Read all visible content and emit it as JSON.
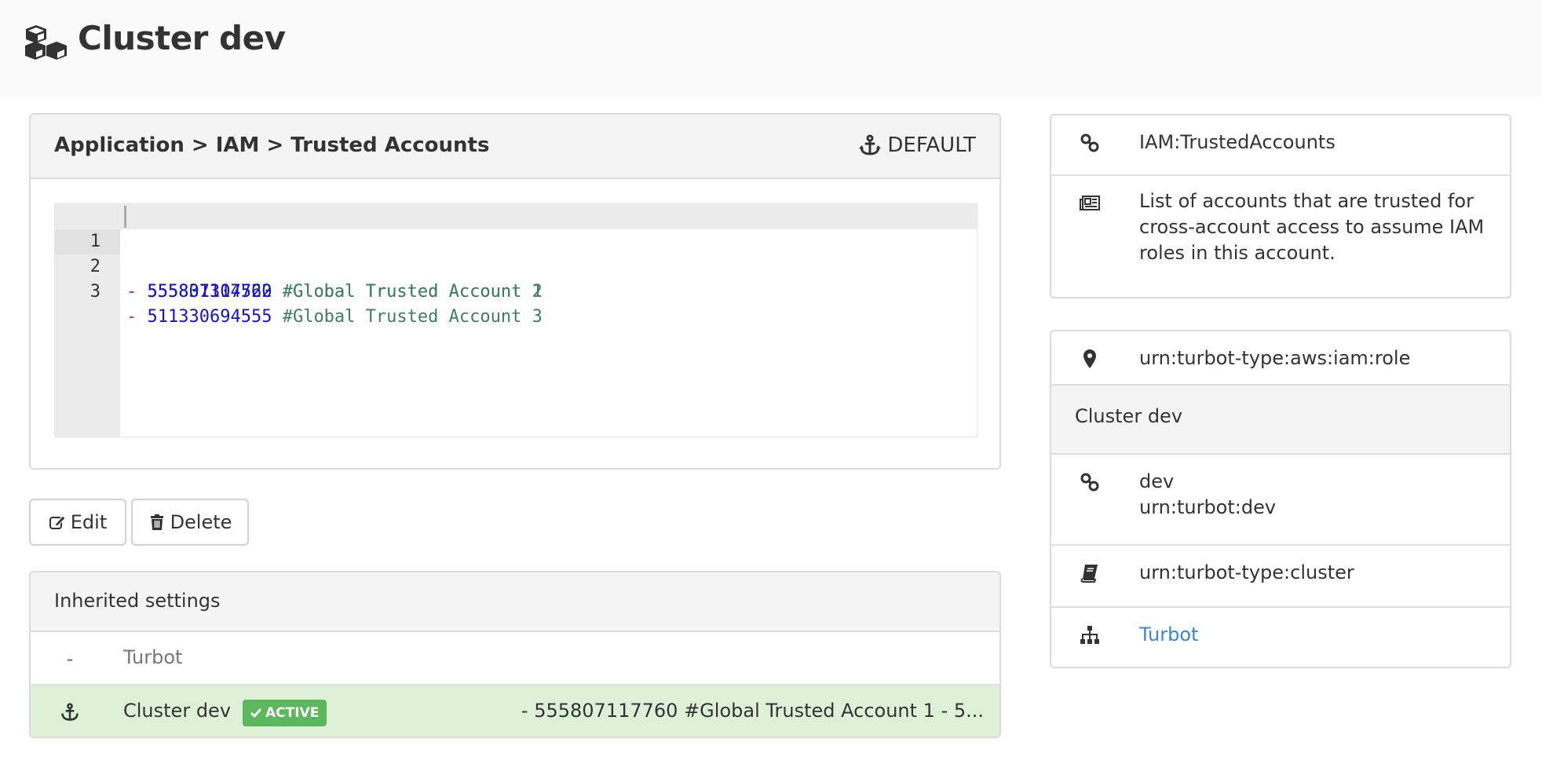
{
  "page": {
    "title": "Cluster dev",
    "title_icon": "cubes-icon"
  },
  "policy": {
    "breadcrumb": "Application > IAM > Trusted Accounts",
    "default_label": "DEFAULT",
    "default_icon": "anchor-icon",
    "editor_lines": [
      {
        "number": "1",
        "dash": "-",
        "account": "555807117760",
        "comment": "#Global Trusted Account 1"
      },
      {
        "number": "2",
        "dash": "-",
        "account": "555831304522",
        "comment": "#Global Trusted Account 2"
      },
      {
        "number": "3",
        "dash": "-",
        "account": "511330694555",
        "comment": "#Global Trusted Account 3"
      }
    ]
  },
  "actions": {
    "edit_label": "Edit",
    "delete_label": "Delete"
  },
  "inherited": {
    "title": "Inherited settings",
    "rows": [
      {
        "marker": "-",
        "name": "Turbot",
        "value": "",
        "active": false
      },
      {
        "marker": "anchor-icon",
        "name": "Cluster dev",
        "badge": "ACTIVE",
        "value": "- 555807117760 #Global Trusted Account 1 - 5...",
        "active": true
      }
    ]
  },
  "sidebar": {
    "policy_name": "IAM:TrustedAccounts",
    "description": "List of accounts that are trusted for cross-account access to assume IAM roles in this account.",
    "target_type": "urn:turbot-type:aws:iam:role",
    "resource": {
      "title": "Cluster dev",
      "name": "dev",
      "urn": "urn:turbot:dev",
      "type": "urn:turbot-type:cluster",
      "parent_link": "Turbot"
    }
  },
  "colors": {
    "active_row_bg": "#dff0d8",
    "badge_bg": "#5cb85c",
    "link": "#3b86d0",
    "yaml_dash": "#c2267f",
    "yaml_number": "#1414c8",
    "yaml_comment": "#3e7f5e"
  }
}
